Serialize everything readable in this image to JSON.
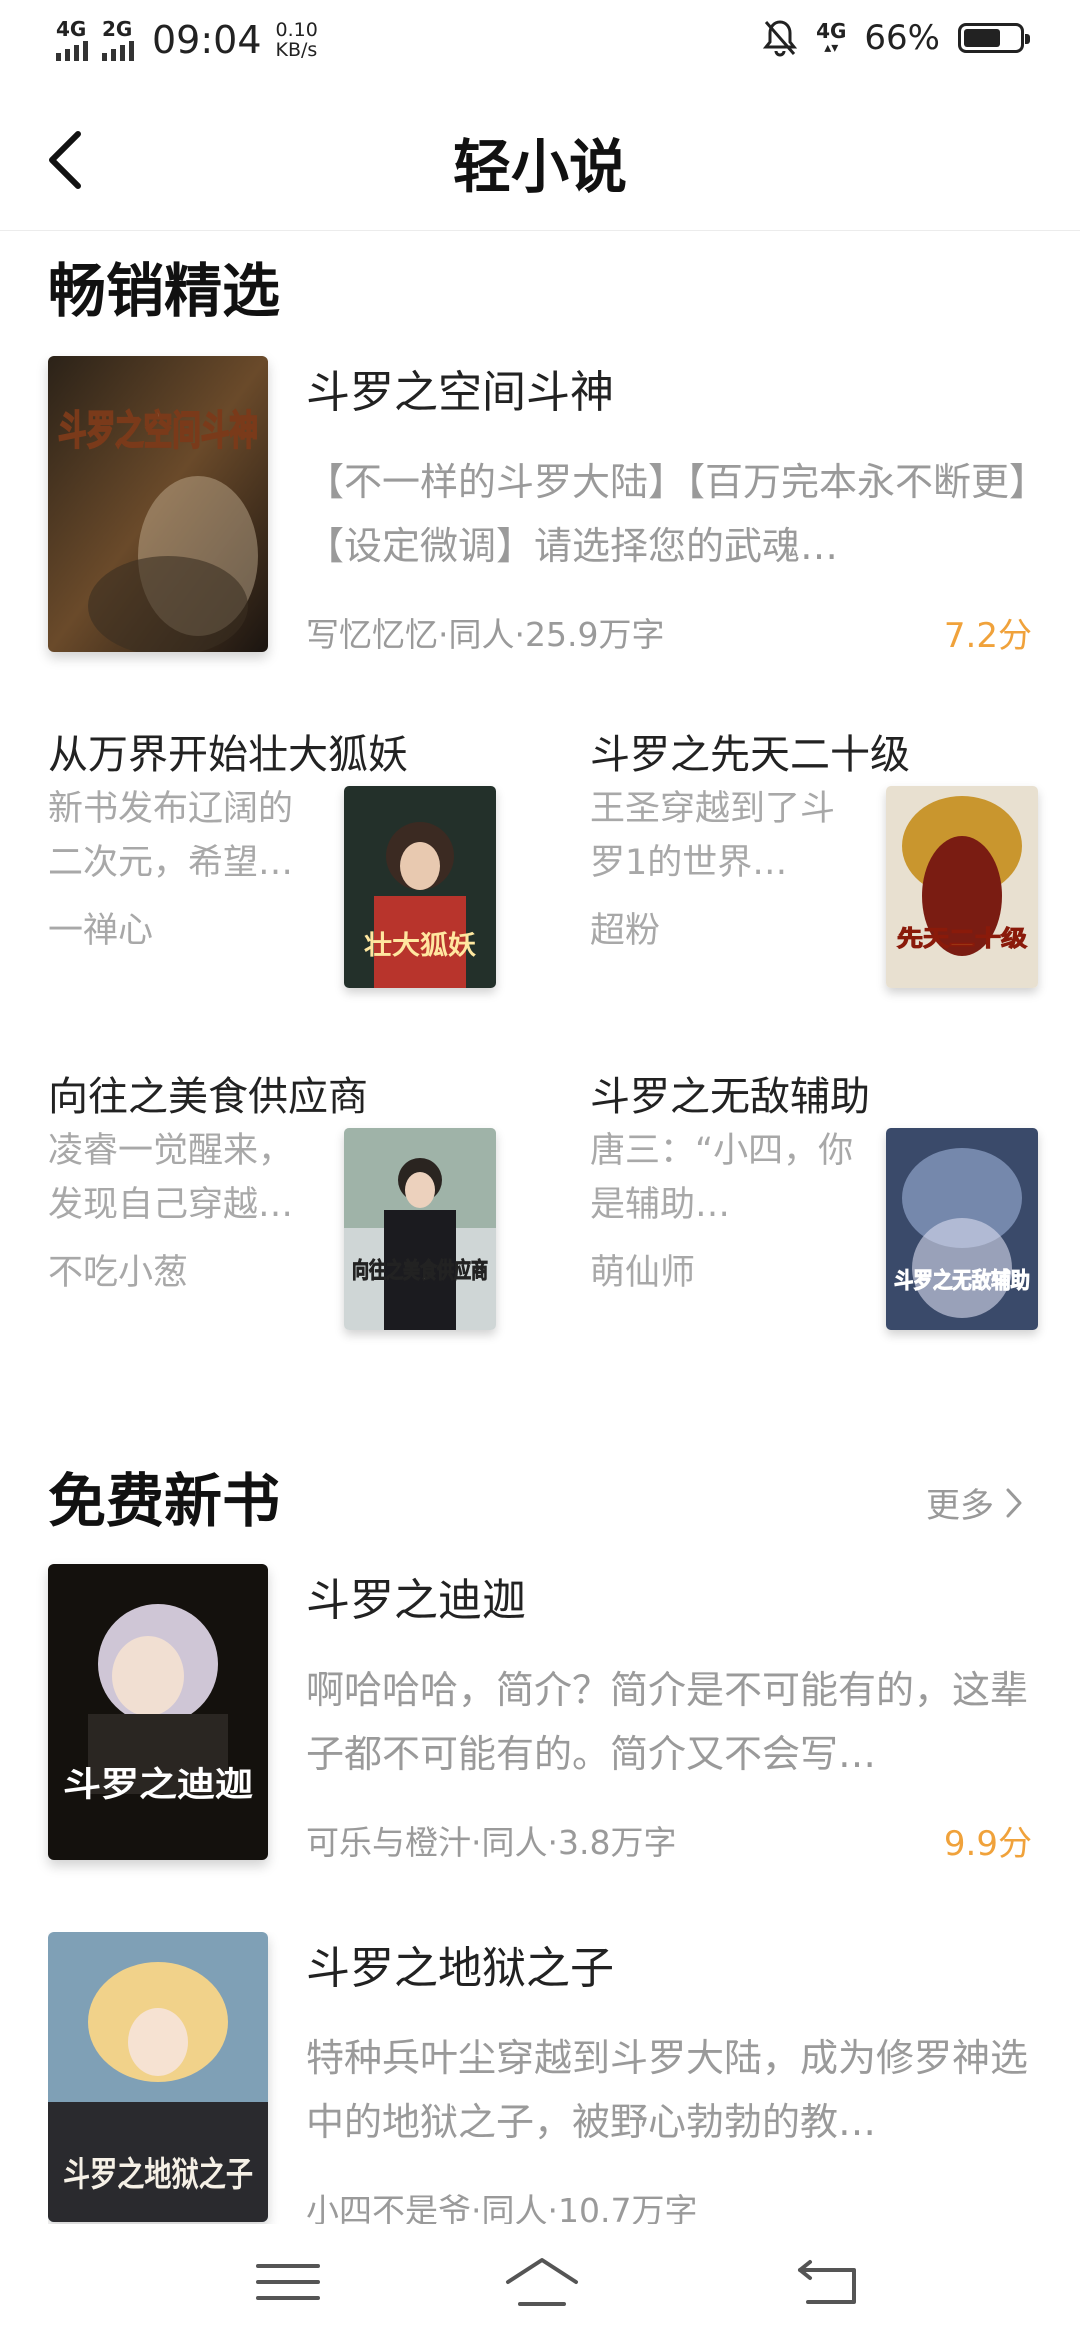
{
  "status_bar": {
    "sim1": "4G",
    "sim2": "2G",
    "time": "09:04",
    "speed_value": "0.10",
    "speed_unit": "KB/s",
    "network": "4G",
    "battery_text": "66%",
    "battery_level": 0.66,
    "icons": [
      "signal-icon",
      "signal-icon",
      "mute-bell-icon",
      "data-network-icon",
      "battery-icon"
    ]
  },
  "header": {
    "title": "轻小说",
    "back_icon": "chevron-left-icon"
  },
  "bestsellers": {
    "title": "畅销精选",
    "featured": {
      "name": "斗罗之空间斗神",
      "description": "【不一样的斗罗大陆】【百万完本永不断更】【设定微调】请选择您的武魂…",
      "meta": "写忆忆忆·同人·25.9万字",
      "score": "7.2分",
      "cover_text": "斗罗之空间斗神"
    },
    "grid": [
      {
        "name": "从万界开始壮大狐妖",
        "description": "新书发布辽阔的二次元，希望…",
        "author": "一禅心",
        "cover_text": "壮大狐妖"
      },
      {
        "name": "斗罗之先天二十级",
        "description": "王圣穿越到了斗罗1的世界…",
        "author": "超粉",
        "cover_text": "先天二十级"
      },
      {
        "name": "向往之美食供应商",
        "description": "凌睿一觉醒来，发现自己穿越…",
        "author": "不吃小葱",
        "cover_text": "向往之美食供应商"
      },
      {
        "name": "斗罗之无敌辅助",
        "description": "唐三：“小四，你是辅助…",
        "author": "萌仙师",
        "cover_text": "斗罗之无敌辅助"
      }
    ]
  },
  "free_new": {
    "title": "免费新书",
    "more_label": "更多",
    "books": [
      {
        "name": "斗罗之迪迦",
        "description": "啊哈哈哈，简介？简介是不可能有的，这辈子都不可能有的。简介又不会写…",
        "meta": "可乐与橙汁·同人·3.8万字",
        "score": "9.9分",
        "cover_text": "斗罗之迪迦"
      },
      {
        "name": "斗罗之地狱之子",
        "description": "特种兵叶尘穿越到斗罗大陆，成为修罗神选中的地狱之子，被野心勃勃的教…",
        "meta": "小四不是爷·同人·10.7万字",
        "score": "",
        "cover_text": "斗罗之地狱之子"
      }
    ]
  },
  "navbar": {
    "icons": [
      "menu-icon",
      "home-icon",
      "back-icon"
    ]
  }
}
